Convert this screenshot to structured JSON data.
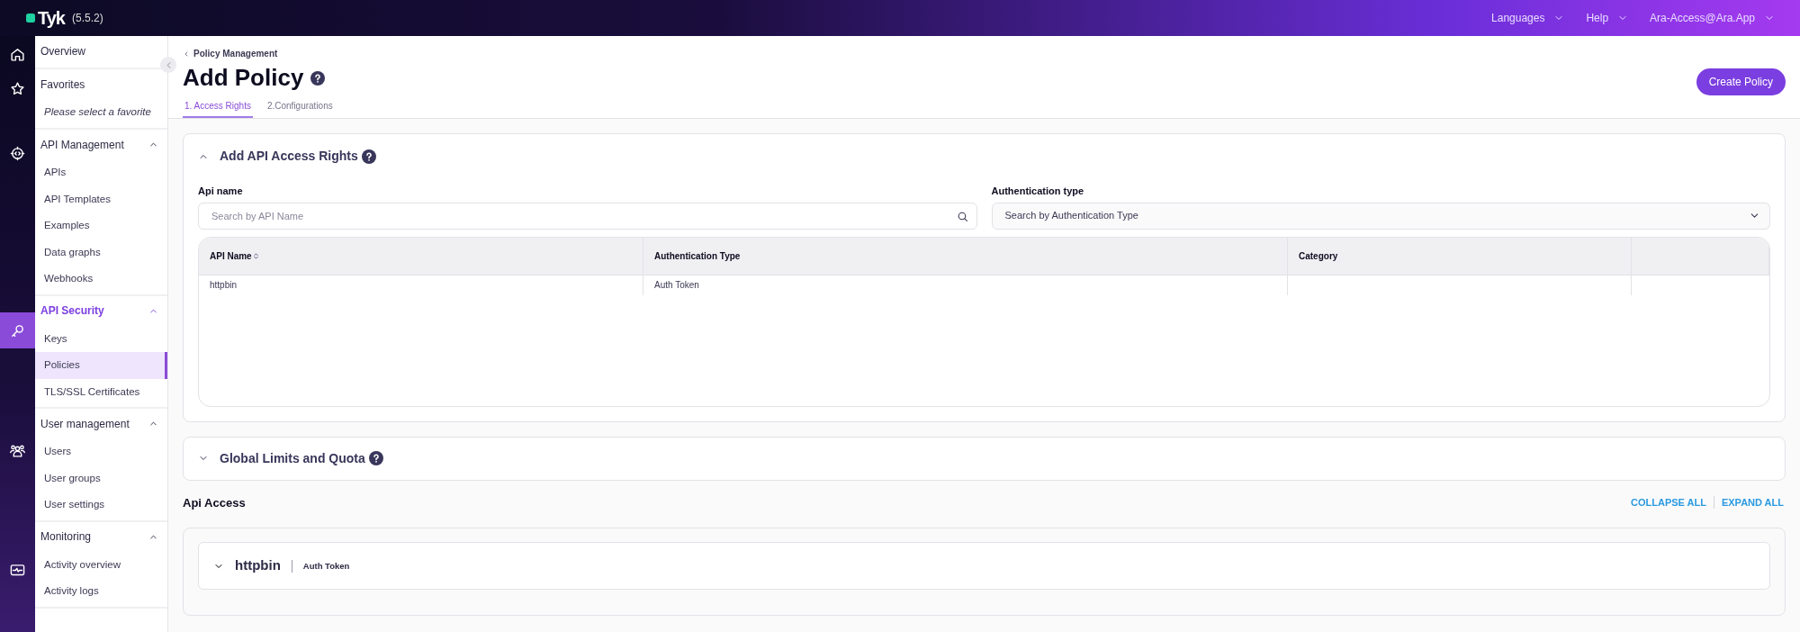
{
  "topbar": {
    "logo": "Tyk",
    "version": "(5.5.2)",
    "menus": [
      {
        "label": "Languages"
      },
      {
        "label": "Help"
      },
      {
        "label": "Ara-Access@Ara.App"
      }
    ]
  },
  "rail": [
    {
      "kind": "home",
      "selected": false
    },
    {
      "kind": "star",
      "selected": false
    },
    {
      "kind": "api",
      "selected": false
    },
    {
      "kind": "key",
      "selected": true
    },
    {
      "kind": "users",
      "selected": false
    },
    {
      "kind": "monitor",
      "selected": false
    }
  ],
  "sidebar": {
    "sections": [
      {
        "title": "Overview"
      },
      {
        "title": "Favorites",
        "note": "Please select a favorite"
      },
      {
        "title": "API Management",
        "expanded": true,
        "selected": false,
        "items": [
          {
            "label": "APIs",
            "selected": false
          },
          {
            "label": "API Templates",
            "selected": false
          },
          {
            "label": "Examples",
            "selected": false
          },
          {
            "label": "Data graphs",
            "selected": false
          },
          {
            "label": "Webhooks",
            "selected": false
          }
        ]
      },
      {
        "title": "API Security",
        "expanded": true,
        "selected": true,
        "items": [
          {
            "label": "Keys",
            "selected": false
          },
          {
            "label": "Policies",
            "selected": true
          },
          {
            "label": "TLS/SSL Certificates",
            "selected": false
          }
        ]
      },
      {
        "title": "User management",
        "expanded": true,
        "selected": false,
        "items": [
          {
            "label": "Users",
            "selected": false
          },
          {
            "label": "User groups",
            "selected": false
          },
          {
            "label": "User settings",
            "selected": false
          }
        ]
      },
      {
        "title": "Monitoring",
        "expanded": true,
        "selected": false,
        "items": [
          {
            "label": "Activity overview",
            "selected": false
          },
          {
            "label": "Activity logs",
            "selected": false
          }
        ]
      }
    ]
  },
  "page": {
    "breadcrumb": "Policy Management",
    "title": "Add Policy",
    "primary_button": "Create Policy",
    "tabs": [
      {
        "label": "1. Access Rights",
        "selected": true
      },
      {
        "label": "2.Configurations",
        "selected": false
      }
    ]
  },
  "access_rights": {
    "title": "Add API Access Rights",
    "expanded": true,
    "api_name": {
      "label": "Api name",
      "placeholder": "Search by API Name"
    },
    "auth_type": {
      "label": "Authentication type",
      "placeholder": "Search by Authentication Type"
    },
    "table": {
      "columns": [
        "API Name",
        "Authentication Type",
        "Category",
        ""
      ],
      "rows": [
        [
          "httpbin",
          "Auth Token",
          "",
          ""
        ]
      ]
    }
  },
  "global_limits": {
    "title": "Global Limits and Quota",
    "expanded": false
  },
  "api_access": {
    "title": "Api Access",
    "actions": [
      "COLLAPSE ALL",
      "EXPAND ALL"
    ],
    "apis": [
      {
        "name": "httpbin",
        "auth": "Auth Token",
        "expanded": false
      }
    ]
  }
}
